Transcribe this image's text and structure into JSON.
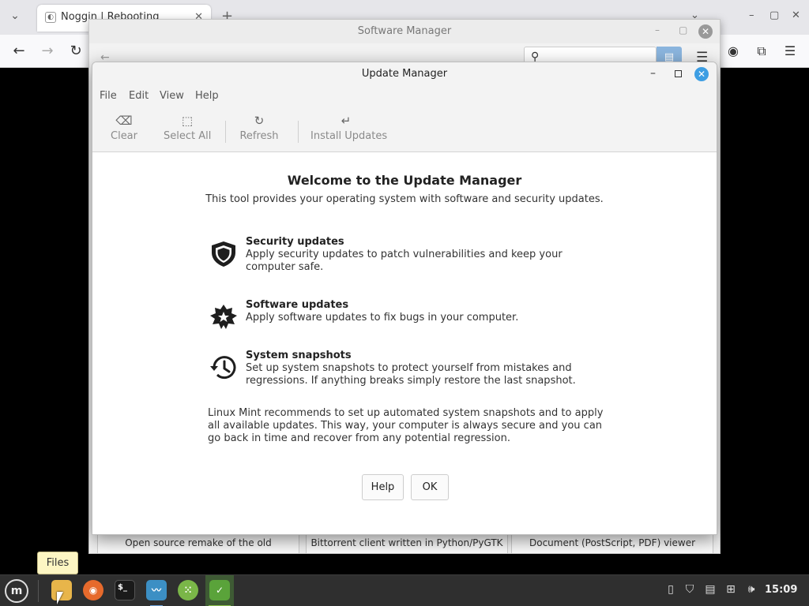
{
  "browser": {
    "tab_title": "Noggin | Rebooting",
    "tab_close": "✕",
    "new_tab": "+",
    "nav": {
      "back": "←",
      "forward": "→",
      "reload": "↻"
    },
    "window": {
      "minimize": "–",
      "maximize": "▢",
      "close": "✕"
    },
    "toolbar_icons": [
      "account-icon",
      "extensions-icon",
      "menu-icon"
    ]
  },
  "software_manager": {
    "title": "Software Manager",
    "search_placeholder": "",
    "cards": [
      "Open source remake of the old",
      "Bittorrent client written in Python/PyGTK",
      "Document (PostScript, PDF) viewer"
    ]
  },
  "update_manager": {
    "title": "Update Manager",
    "menu": [
      "File",
      "Edit",
      "View",
      "Help"
    ],
    "toolbar": {
      "clear": "Clear",
      "select_all": "Select All",
      "refresh": "Refresh",
      "install_updates": "Install Updates"
    },
    "welcome": {
      "title": "Welcome to the Update Manager",
      "subtitle": "This tool provides your operating system with software and security updates."
    },
    "features": [
      {
        "title": "Security updates",
        "desc": "Apply security updates to patch vulnerabilities and keep your computer safe.",
        "icon": "shield-icon"
      },
      {
        "title": "Software updates",
        "desc": "Apply software updates to fix bugs in your computer.",
        "icon": "badge-star-icon"
      },
      {
        "title": "System snapshots",
        "desc": "Set up system snapshots to protect yourself from mistakes and regressions. If anything breaks simply restore the last snapshot.",
        "icon": "history-icon"
      }
    ],
    "recommendation": "Linux Mint recommends to set up automated system snapshots and to apply all available updates. This way, your computer is always secure and you can go back in time and recover from any potential regression.",
    "buttons": {
      "help": "Help",
      "ok": "OK"
    }
  },
  "tooltip": "Files",
  "taskbar": {
    "apps": [
      {
        "name": "Files",
        "icon": "folder-icon",
        "color": "#e8b54a"
      },
      {
        "name": "Firefox",
        "icon": "firefox-icon",
        "color": "#e66a2c"
      },
      {
        "name": "Terminal",
        "icon": "terminal-icon",
        "color": "#222222"
      },
      {
        "name": "System Monitor",
        "icon": "system-monitor-icon",
        "color": "#3c8fc4"
      },
      {
        "name": "Calculator",
        "icon": "calculator-icon",
        "color": "#7ab648"
      },
      {
        "name": "Update Manager",
        "icon": "shield-check-icon",
        "color": "#5aa33a"
      }
    ],
    "terminal_glyph": "$_",
    "clock": "15:09"
  },
  "colors": {
    "accent_close": "#3d9ee3",
    "taskbar_bg": "#2f2f2f",
    "tooltip_bg": "#fdf6c3"
  }
}
